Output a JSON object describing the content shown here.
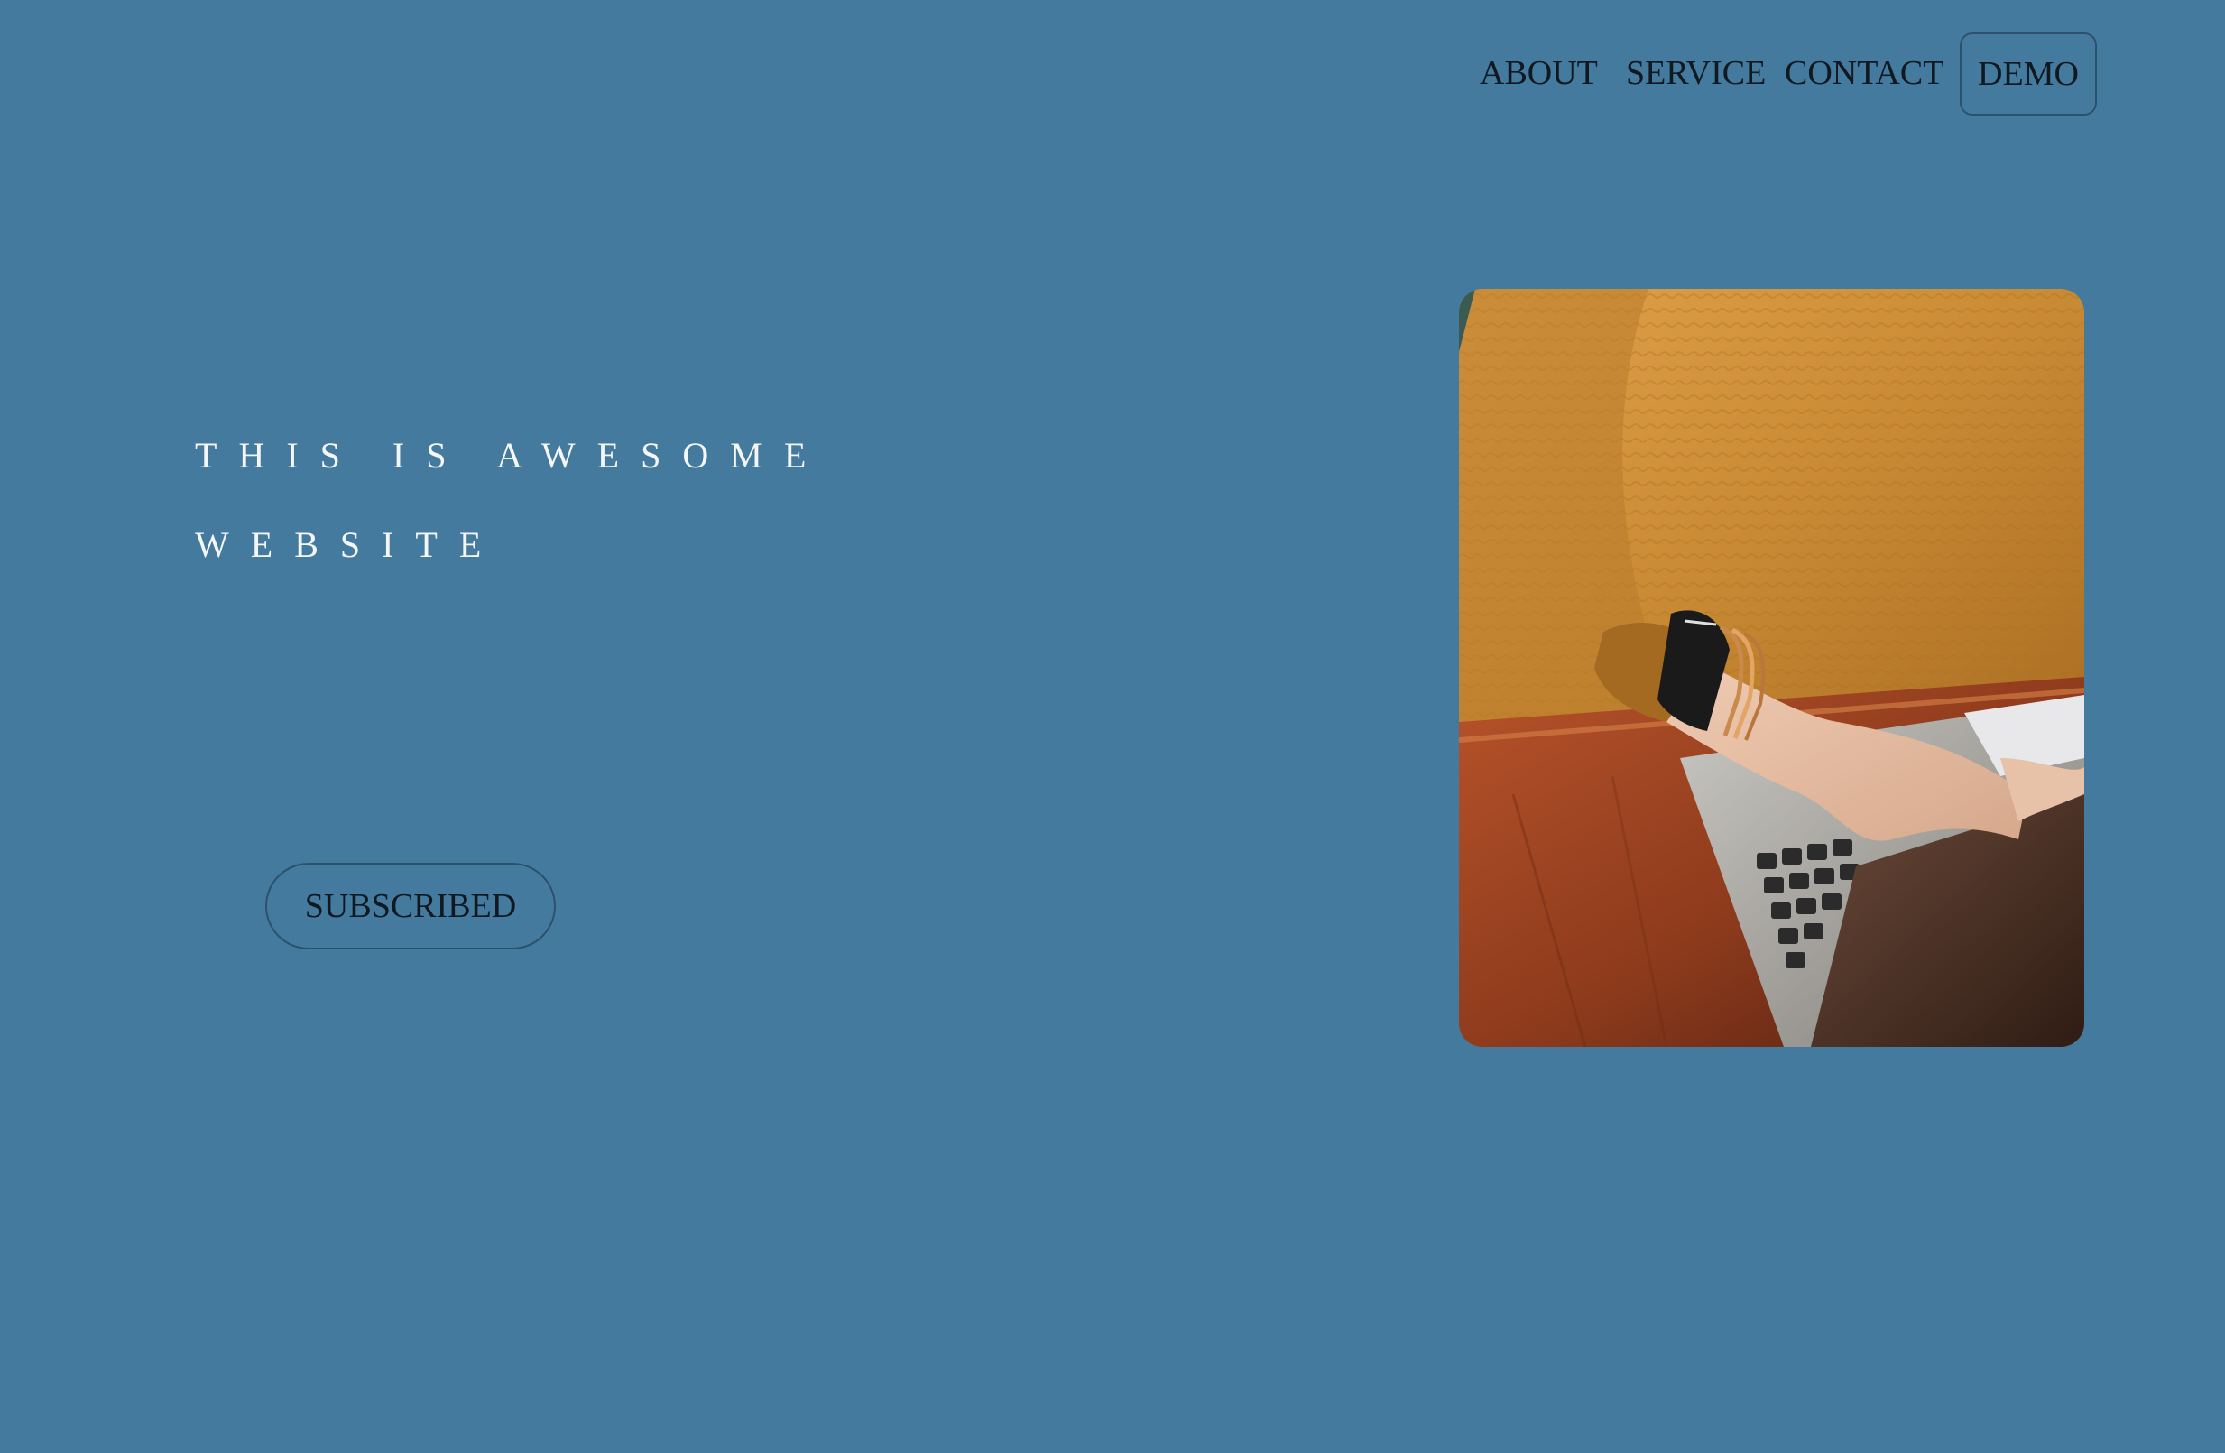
{
  "nav": {
    "about": "ABOUT",
    "service": "SERVICE",
    "contact": "CONTACT",
    "demo": "DEMO"
  },
  "hero": {
    "line1": "THIS IS AWESOME",
    "line2": "WEBSITE",
    "cta": "SUBSCRIBED"
  },
  "image": {
    "icon": "laptop-photo"
  },
  "colors": {
    "background": "#447a9e",
    "hero_text": "#f4f6f8",
    "nav_text": "#101820",
    "border": "#2c516d"
  }
}
